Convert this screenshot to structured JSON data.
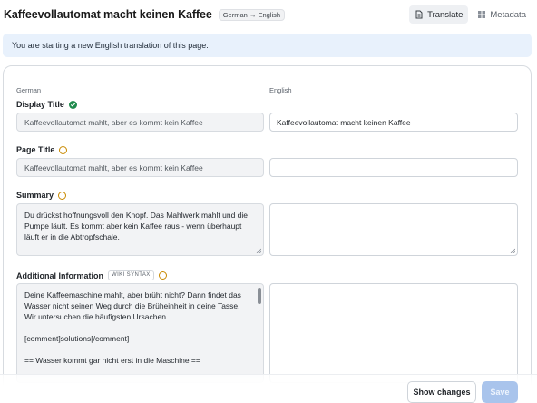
{
  "header": {
    "title": "Kaffeevollautomat macht keinen Kaffee",
    "language_badge": "German → English",
    "tabs": [
      {
        "label": "Translate",
        "icon": "file-edit-icon",
        "active": true
      },
      {
        "label": "Metadata",
        "icon": "grid-icon",
        "active": false
      }
    ]
  },
  "notice": {
    "text": "You are starting a new English translation of this page."
  },
  "columns": {
    "source": "German",
    "target": "English"
  },
  "fields": {
    "display_title": {
      "label": "Display Title",
      "status": "complete",
      "source": "Kaffeevollautomat mahlt, aber es kommt kein Kaffee",
      "target": "Kaffeevollautomat macht keinen Kaffee"
    },
    "page_title": {
      "label": "Page Title",
      "status": "pending",
      "source": "Kaffeevollautomat mahlt, aber es kommt kein Kaffee",
      "target": ""
    },
    "summary": {
      "label": "Summary",
      "status": "pending",
      "source_lines": [
        "Du drückst hoffnungsvoll den Knopf. Das Mahlwerk mahlt und die",
        "Pumpe läuft. Es kommt aber kein Kaffee raus - wenn überhaupt",
        "läuft er in die Abtropfschale."
      ],
      "target": ""
    },
    "additional_information": {
      "label": "Additional Information",
      "badge": "WIKI SYNTAX",
      "status": "pending",
      "source_lines": [
        "Deine Kaffeemaschine mahlt, aber brüht nicht? Dann findet das",
        "Wasser nicht seinen Weg durch die Brüheinheit in deine Tasse.",
        "Wir untersuchen die häufigsten Ursachen.",
        "",
        "[comment]solutions[/comment]",
        "",
        "== Wasser kommt gar nicht erst in die Maschine =="
      ],
      "target": ""
    }
  },
  "footer": {
    "show_changes": "Show changes",
    "save": "Save"
  },
  "colors": {
    "accent": "#a9c4ec",
    "notice_bg": "#e8f1fc",
    "complete": "#1f8a4c",
    "pending": "#c98a00"
  }
}
